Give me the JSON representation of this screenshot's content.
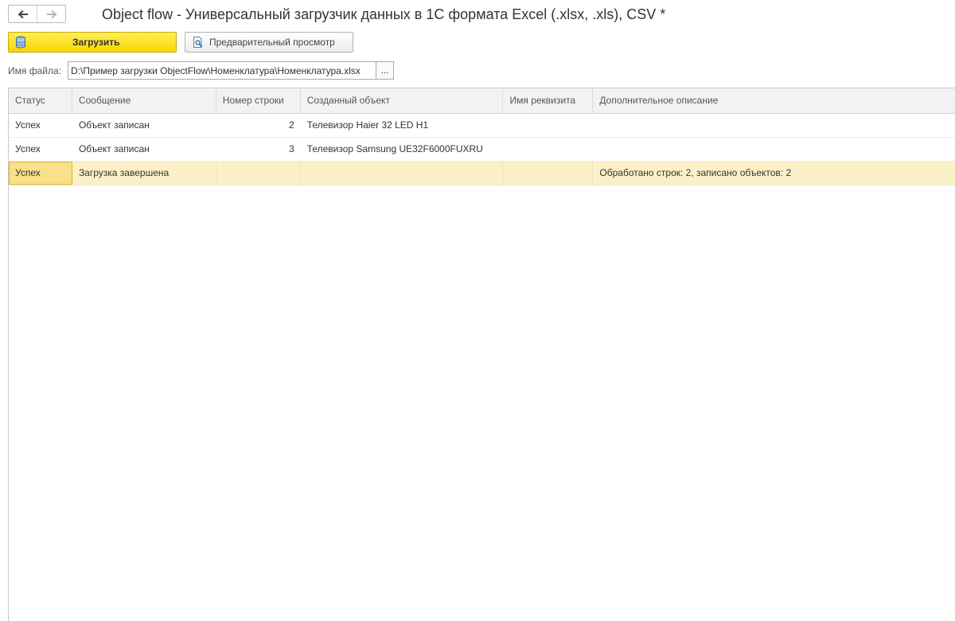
{
  "window": {
    "title": "Object flow - Универсальный загрузчик данных в 1С формата Excel (.xlsx, .xls), CSV *",
    "nav_back_icon": "arrow-left-icon",
    "nav_forward_icon": "arrow-right-icon"
  },
  "toolbar": {
    "load_label": "Загрузить",
    "load_icon": "database-icon",
    "preview_label": "Предварительный просмотр",
    "preview_icon": "document-magnifier-icon",
    "accent_color": "#f5d800"
  },
  "file": {
    "label": "Имя файла:",
    "value": "D:\\Пример загрузки ObjectFlow\\Номенклатура\\Номенклатура.xlsx",
    "browse_label": "..."
  },
  "table": {
    "columns": [
      "Статус",
      "Сообщение",
      "Номер строки",
      "Созданный объект",
      "Имя реквизита",
      "Дополнительное описание"
    ],
    "rows": [
      {
        "status": "Успех",
        "message": "Объект записан",
        "row_number": "2",
        "object": "Телевизор Haier 32 LED H1",
        "attribute": "",
        "description": ""
      },
      {
        "status": "Успех",
        "message": "Объект записан",
        "row_number": "3",
        "object": "Телевизор Samsung UE32F6000FUXRU",
        "attribute": "",
        "description": ""
      },
      {
        "status": "Успех",
        "message": "Загрузка завершена",
        "row_number": "",
        "object": "",
        "attribute": "",
        "description": "Обработано строк: 2, записано объектов: 2"
      }
    ],
    "selected_row_color": "#fbf0c6"
  }
}
